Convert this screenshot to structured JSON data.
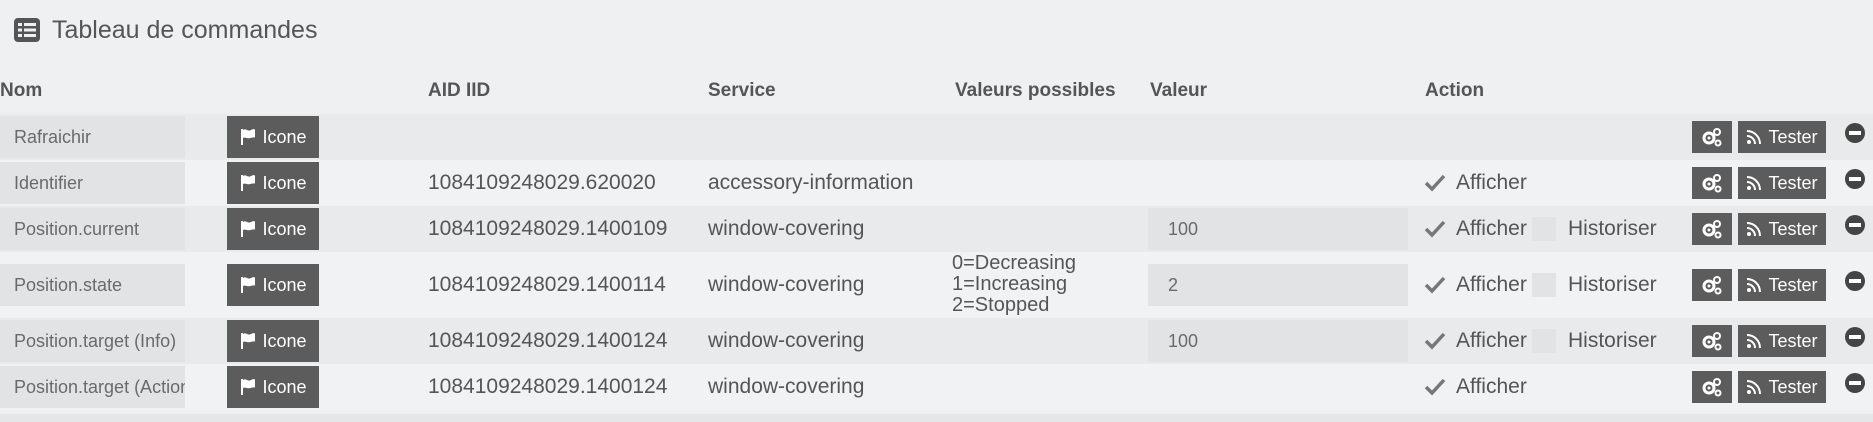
{
  "title": "Tableau de commandes",
  "headers": {
    "nom": "Nom",
    "aid_iid": "AID IID",
    "service": "Service",
    "valeurs_possibles": "Valeurs possibles",
    "valeur": "Valeur",
    "action": "Action"
  },
  "buttons": {
    "icone": "Icone",
    "tester": "Tester",
    "afficher": "Afficher",
    "historiser": "Historiser"
  },
  "rows": [
    {
      "name": "Rafraichir",
      "aid": "",
      "service": "",
      "valeurs": [],
      "value": null,
      "afficher": false,
      "historiser": false
    },
    {
      "name": "Identifier",
      "aid": "1084109248029.620020",
      "service": "accessory-information",
      "valeurs": [],
      "value": null,
      "afficher": true,
      "historiser": false
    },
    {
      "name": "Position.current",
      "aid": "1084109248029.1400109",
      "service": "window-covering",
      "valeurs": [],
      "value": "100",
      "afficher": true,
      "historiser": true
    },
    {
      "name": "Position.state",
      "aid": "1084109248029.1400114",
      "service": "window-covering",
      "valeurs": [
        "0=Decreasing",
        "1=Increasing",
        "2=Stopped"
      ],
      "value": "2",
      "afficher": true,
      "historiser": true
    },
    {
      "name": "Position.target (Info)",
      "aid": "1084109248029.1400124",
      "service": "window-covering",
      "valeurs": [],
      "value": "100",
      "afficher": true,
      "historiser": true
    },
    {
      "name": "Position.target (Action)",
      "aid": "1084109248029.1400124",
      "service": "window-covering",
      "valeurs": [],
      "value": null,
      "afficher": true,
      "historiser": false
    }
  ]
}
